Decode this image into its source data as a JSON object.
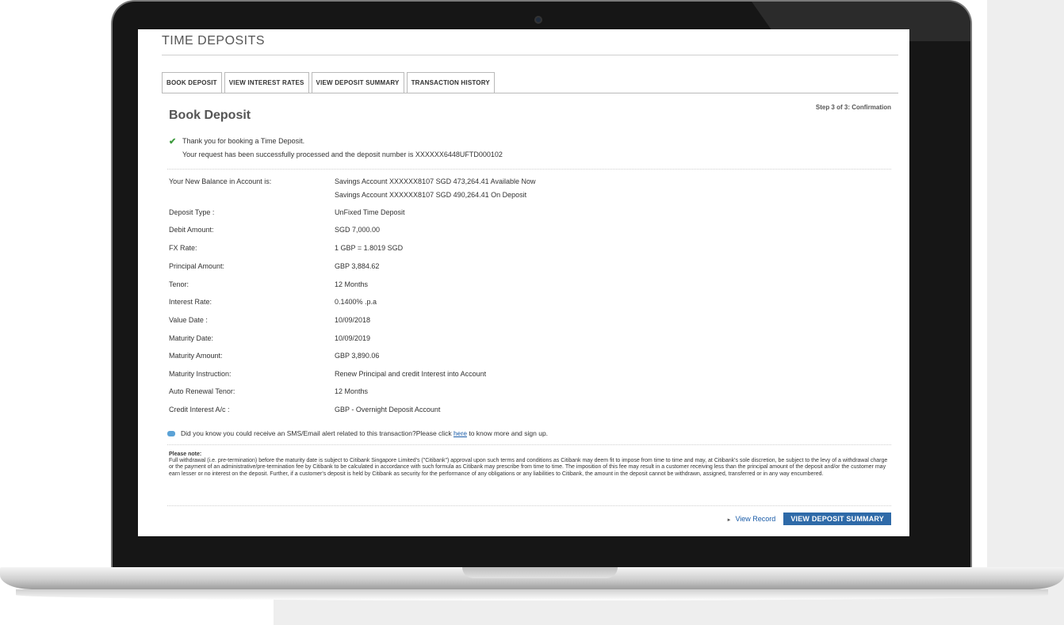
{
  "page": {
    "title": "TIME DEPOSITS",
    "step": "Step 3 of 3: Confirmation",
    "section_title": "Book Deposit"
  },
  "tabs": [
    {
      "label": "BOOK DEPOSIT",
      "active": true
    },
    {
      "label": "VIEW INTEREST RATES",
      "active": false
    },
    {
      "label": "VIEW DEPOSIT SUMMARY",
      "active": false
    },
    {
      "label": "TRANSACTION HISTORY",
      "active": false
    }
  ],
  "confirmation": {
    "icon": "check-icon",
    "line1": "Thank you for booking a Time Deposit.",
    "line2": "Your request has been successfully processed and the deposit number is XXXXXX6448UFTD000102"
  },
  "details": [
    {
      "label": "Your New Balance in Account is:",
      "values": [
        "Savings Account XXXXXX8107 SGD 473,264.41 Available Now",
        "Savings Account XXXXXX8107 SGD 490,264.41 On Deposit"
      ]
    },
    {
      "label": "Deposit Type :",
      "values": [
        "UnFixed Time Deposit"
      ]
    },
    {
      "label": "Debit Amount:",
      "values": [
        "SGD 7,000.00"
      ]
    },
    {
      "label": "FX Rate:",
      "values": [
        "1 GBP = 1.8019 SGD"
      ]
    },
    {
      "label": "Principal Amount:",
      "values": [
        "GBP 3,884.62"
      ]
    },
    {
      "label": "Tenor:",
      "values": [
        "12 Months"
      ]
    },
    {
      "label": "Interest Rate:",
      "values": [
        "0.1400% .p.a"
      ]
    },
    {
      "label": "Value Date :",
      "values": [
        "10/09/2018"
      ]
    },
    {
      "label": "Maturity Date:",
      "values": [
        "10/09/2019"
      ]
    },
    {
      "label": "Maturity Amount:",
      "values": [
        "GBP 3,890.06"
      ]
    },
    {
      "label": "Maturity Instruction:",
      "values": [
        "Renew Principal and credit Interest into Account"
      ]
    },
    {
      "label": "Auto Renewal Tenor:",
      "values": [
        "12 Months"
      ]
    },
    {
      "label": "Credit Interest A/c :",
      "values": [
        "GBP - Overnight Deposit Account"
      ]
    }
  ],
  "alert": {
    "icon": "chat-bubble-icon",
    "text_before": "Did you know you could receive an SMS/Email alert related to this transaction?Please click ",
    "link": "here",
    "text_after": " to know more and sign up."
  },
  "note": {
    "title": "Please note:",
    "body": "Full withdrawal (i.e. pre-termination) before the maturity date is subject to Citibank Singapore Limited's (\"Citibank\") approval upon such terms and conditions as Citibank may deem fit to impose from time to time and may, at Citibank's sole discretion, be subject to the levy of a withdrawal charge or the payment of an administrative/pre-termination fee by Citibank to be calculated in accordance with such formula as Citibank may prescribe from time to time. The imposition of this fee may result in a customer receiving less than the principal amount of the deposit and/or the customer may earn lesser or no interest on the deposit. Further, if a customer's deposit is held by Citibank as security for the performance of any obligations or any liabilities to Citibank, the amount in the deposit cannot be withdrawn, assigned, transferred or in any way encumbered."
  },
  "actions": {
    "view_record": "View Record",
    "view_deposit_summary": "VIEW DEPOSIT SUMMARY"
  },
  "colors": {
    "primary_button": "#2e6aa8",
    "link": "#1a5ca8",
    "success_check": "#3c9a3c"
  }
}
